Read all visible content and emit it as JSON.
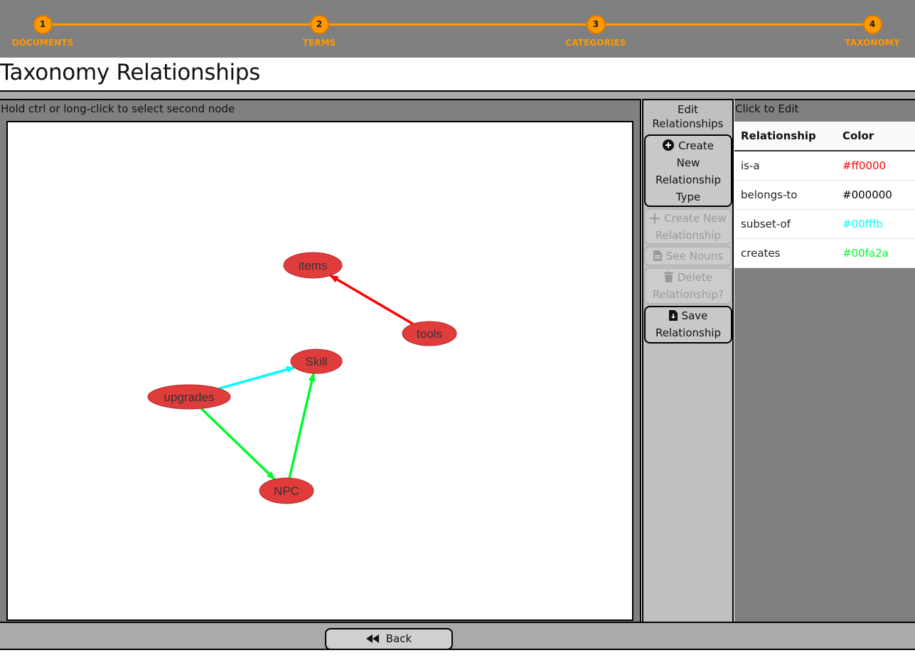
{
  "stepper": {
    "accent_color": "#ff9900",
    "steps": [
      {
        "number": "1",
        "label": "DOCUMENTS"
      },
      {
        "number": "2",
        "label": "TERMS"
      },
      {
        "number": "3",
        "label": "CATEGORIES"
      },
      {
        "number": "4",
        "label": "TAXONOMY"
      }
    ]
  },
  "page_title": "Taxonomy Relationships",
  "graph": {
    "hint": "Hold ctrl or long-click to select second node",
    "node_color": "#e03c3c",
    "nodes": [
      "items",
      "tools",
      "Skill",
      "upgrades",
      "NPC"
    ],
    "edges": [
      {
        "from": "tools",
        "to": "items",
        "relationship": "is-a",
        "color": "#ff0000"
      },
      {
        "from": "upgrades",
        "to": "Skill",
        "relationship": "subset-of",
        "color": "#00fffb"
      },
      {
        "from": "upgrades",
        "to": "NPC",
        "relationship": "creates",
        "color": "#00fa2a"
      },
      {
        "from": "NPC",
        "to": "Skill",
        "relationship": "creates",
        "color": "#00fa2a"
      }
    ]
  },
  "edit_panel": {
    "heading": "Edit Relationships",
    "create_type_label": "Create New Relationship Type",
    "create_relationship_label": "Create New Relationship",
    "see_nouns_label": "See Nouns",
    "delete_label": "Delete Relationship?",
    "save_label": "Save Relationship",
    "icons": {
      "create_type": "plus-circle-icon",
      "create_relationship": "plus-icon",
      "see_nouns": "document-icon",
      "delete": "trash-icon",
      "save": "file-download-icon"
    }
  },
  "relationships_panel": {
    "heading": "Click to Edit",
    "columns": [
      "Relationship",
      "Color"
    ],
    "rows": [
      {
        "name": "is-a",
        "color": "#ff0000"
      },
      {
        "name": "belongs-to",
        "color": "#000000"
      },
      {
        "name": "subset-of",
        "color": "#00fffb"
      },
      {
        "name": "creates",
        "color": "#00fa2a"
      }
    ]
  },
  "footer": {
    "back_label": "Back",
    "back_icon": "rewind-icon"
  }
}
